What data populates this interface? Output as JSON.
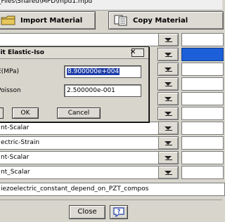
{
  "window": {
    "path_title": "_Files\\Shared\\MPD\\mpd1.mpd"
  },
  "toolbar": {
    "import_label": "Import Material",
    "import_icon": "folder-icon",
    "copy_label": "Copy Material",
    "copy_icon": "copy-document-icon"
  },
  "rows": [
    {
      "text": "nt-Scalar"
    },
    {
      "text": "ectric-Strain"
    },
    {
      "text": "nt-Scalar"
    },
    {
      "text": "nt_Scalar"
    }
  ],
  "long_row": {
    "text": "iezoelectric_constant_depend_on_PZT_compos"
  },
  "dialog": {
    "title": "dit Elastic-Iso",
    "close_glyph": "✕",
    "e_label": "E(MPa)",
    "e_value": "8.900000e+004",
    "poisson_label": "Poisson",
    "poisson_value": "2.500000e-001",
    "ok_label": "OK",
    "cancel_label": "Cancel"
  },
  "footer": {
    "close_label": "Close",
    "help_icon": "help-icon"
  },
  "colors": {
    "selection": "#1c5fd8",
    "background": "#d8d5cc"
  }
}
